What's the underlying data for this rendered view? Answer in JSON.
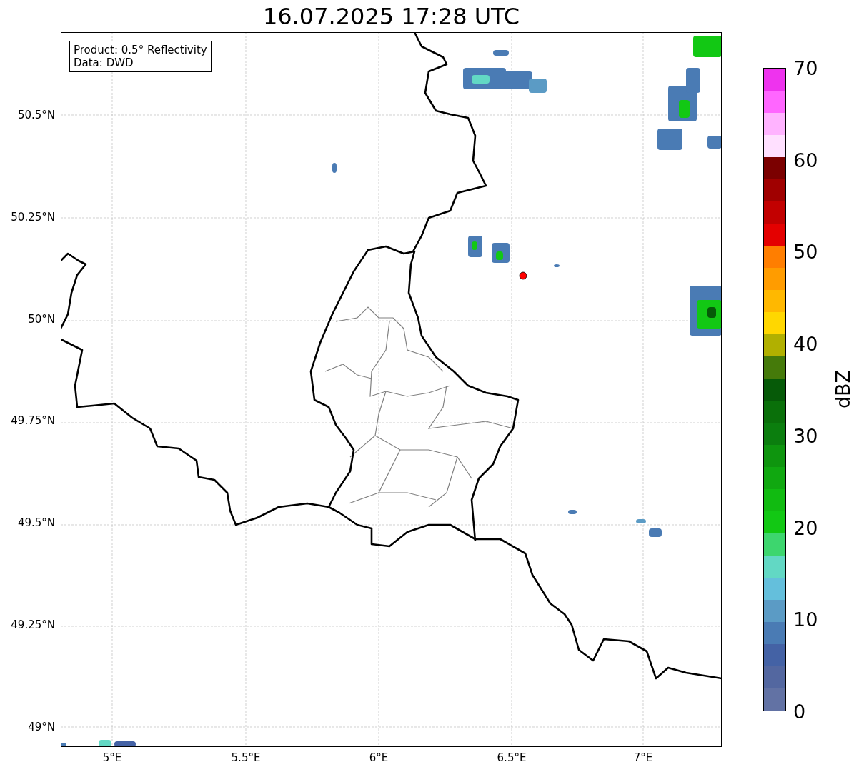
{
  "title": "16.07.2025 17:28 UTC",
  "legend": {
    "lines": [
      "Product: 0.5° Reflectivity",
      "Data: DWD"
    ]
  },
  "map": {
    "xticks": [
      "5°E",
      "5.5°E",
      "6°E",
      "6.5°E",
      "7°E"
    ],
    "yticks": [
      "50.5°N",
      "50.25°N",
      "50°N",
      "49.75°N",
      "49.5°N",
      "49.25°N",
      "49°N"
    ]
  },
  "colorbar": {
    "label": "dBZ",
    "ticks": [
      "70",
      "60",
      "50",
      "40",
      "30",
      "20",
      "10",
      "0"
    ],
    "segments": [
      {
        "color": "#ee33ee"
      },
      {
        "color": "#ff66ff"
      },
      {
        "color": "#ffb3ff"
      },
      {
        "color": "#ffe0ff"
      },
      {
        "color": "#7b0000"
      },
      {
        "color": "#a00000"
      },
      {
        "color": "#c20000"
      },
      {
        "color": "#e40000"
      },
      {
        "color": "#ff7e00"
      },
      {
        "color": "#ff9c00"
      },
      {
        "color": "#ffb800"
      },
      {
        "color": "#ffd700"
      },
      {
        "color": "#b1b000"
      },
      {
        "color": "#457a0a"
      },
      {
        "color": "#065a08"
      },
      {
        "color": "#0a700a"
      },
      {
        "color": "#0b7e0e"
      },
      {
        "color": "#0e950e"
      },
      {
        "color": "#10a810"
      },
      {
        "color": "#11bb11"
      },
      {
        "color": "#12c814"
      },
      {
        "color": "#3dd66e"
      },
      {
        "color": "#62d8c4"
      },
      {
        "color": "#64bfdc"
      },
      {
        "color": "#5b9bc5"
      },
      {
        "color": "#4a7bb4"
      },
      {
        "color": "#4462a5"
      },
      {
        "color": "#5367a0"
      },
      {
        "color": "#6272a4"
      }
    ]
  }
}
